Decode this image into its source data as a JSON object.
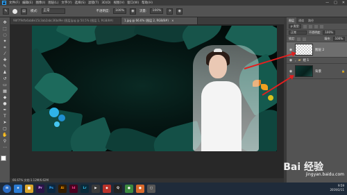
{
  "app": {
    "logo": "Ps"
  },
  "menu": [
    "文件(F)",
    "编辑(E)",
    "图像(I)",
    "图层(L)",
    "文字(Y)",
    "选择(S)",
    "滤镜(T)",
    "3D(D)",
    "视图(V)",
    "窗口(W)",
    "帮助(H)"
  ],
  "window_controls": [
    "—",
    "□",
    "✕"
  ],
  "options": {
    "mode_label": "模式:",
    "mode_value": "正常",
    "opacity_label": "不透明度:",
    "opacity_value": "100%",
    "flow_label": "流量:",
    "flow_value": "100%"
  },
  "tabs": [
    {
      "label": "98f7f9dfa6ab8e15c3ab2abc36bd9e (图层)jpg @ 50.5% (图层 1, RGB/8#)",
      "active": false
    },
    {
      "label": "1.jpg @ 66.6% (图层 2, RGB/8#)",
      "active": true
    }
  ],
  "status": "66.67%   文档:1.12M/6.62M",
  "layers_panel": {
    "tabs": [
      "图层",
      "通道",
      "路径"
    ],
    "filter_label": "ρ 类型",
    "blend_mode": "正常",
    "opacity_label": "不透明度:",
    "opacity_value": "100%",
    "lock_label": "锁定:",
    "fill_label": "填充:",
    "fill_value": "100%",
    "layers": [
      {
        "name": "图层 2",
        "thumb": "transparent",
        "selected": true
      },
      {
        "name": "组 1",
        "thumb": "group",
        "selected": false
      },
      {
        "name": "背景",
        "thumb": "photo",
        "selected": false
      }
    ]
  },
  "taskbar": {
    "apps": [
      {
        "icon": "ie-icon",
        "label": "e",
        "color": "#2b7bd3"
      },
      {
        "icon": "folder-icon",
        "label": "▆",
        "color": "#d9a52b"
      },
      {
        "icon": "premiere-icon",
        "label": "Pr",
        "color": "#2a1447"
      },
      {
        "icon": "photoshop-icon",
        "label": "Ps",
        "color": "#0b2740"
      },
      {
        "icon": "illustrator-icon",
        "label": "Ai",
        "color": "#331c00"
      },
      {
        "icon": "indesign-icon",
        "label": "Id",
        "color": "#49021f"
      },
      {
        "icon": "lightroom-icon",
        "label": "Lr",
        "color": "#0a2a3a"
      },
      {
        "icon": "media-icon",
        "label": "▶",
        "color": "#3a3a3a"
      },
      {
        "icon": "store-icon",
        "label": "◆",
        "color": "#b8322a"
      },
      {
        "icon": "qq-icon",
        "label": "Q",
        "color": "#222"
      },
      {
        "icon": "chrome-icon",
        "label": "●",
        "color": "#3c8a3f"
      },
      {
        "icon": "firefox-icon",
        "label": "●",
        "color": "#d8692b"
      },
      {
        "icon": "explorer-icon",
        "label": "▢",
        "color": "#555"
      }
    ],
    "time": "9:59",
    "date": "2019/2/11"
  },
  "watermark": {
    "text": "Bai 经验",
    "url": "jingyan.baidu.com"
  }
}
